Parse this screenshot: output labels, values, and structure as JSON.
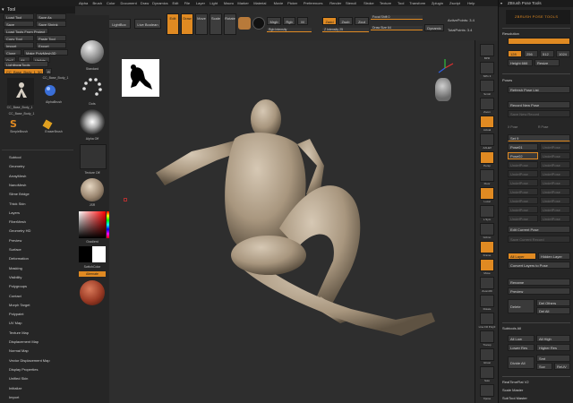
{
  "top_menu": [
    "Alpha",
    "Brush",
    "Color",
    "Document",
    "Draw",
    "Dynamics",
    "Edit",
    "File",
    "Layer",
    "Light",
    "Macro",
    "Marker",
    "Material",
    "Movie",
    "Picker",
    "Preferences",
    "Render",
    "Stencil",
    "Stroke",
    "Texture",
    "Tool",
    "Transform",
    "Zplugin",
    "Zscript",
    "Help"
  ],
  "tool_panel": {
    "title": "Tool",
    "buttons": [
      "Load Tool",
      "Save As",
      "Save",
      "Save Shrink",
      "Load Tools From Project",
      "Copy Tool",
      "Paste Tool",
      "Import",
      "Export",
      "Clone",
      "Make PolyMesh3D",
      "GoZ",
      "All",
      "Visible",
      "R"
    ],
    "lightbox_tools": "Lightbox▸Tools",
    "current_tool": "CC_Base_Body_1. 50",
    "thumbs": [
      {
        "label": "CC_Base_Body_1"
      },
      {
        "label": "CC_Base_Body_1"
      },
      {
        "label": "AlphaBrush"
      },
      {
        "label": "CC_Base_Body_1"
      },
      {
        "label": "SimpleBrush"
      },
      {
        "label": "EraserBrush"
      }
    ],
    "subtools": [
      "Subtool",
      "Geometry",
      "ArrayMesh",
      "NanoMesh",
      "Slime Bridge",
      "Thick Skin",
      "Layers",
      "FiberMesh",
      "Geometry HD",
      "Preview",
      "Surface",
      "Deformation",
      "Masking",
      "Visibility",
      "Polygroups",
      "Contact",
      "Morph Target",
      "Polypaint",
      "UV Map",
      "Texture Map",
      "Displacement Map",
      "Normal Map",
      "Vector Displacement Map",
      "Display Properties",
      "Unified Skin",
      "Initialize",
      "Import"
    ]
  },
  "material_column": {
    "standard": "Standard",
    "dots": "Dots",
    "alpha": "Alpha Off",
    "texture": "Texture Off",
    "matcap": "JSR",
    "gradient": "Gradient",
    "switch_color": "SwitchColor",
    "alternate": "Alternate"
  },
  "top_shelf": {
    "home_page": "Home Page",
    "lightbox": "LightBox",
    "live_boolean": "Live Boolean",
    "edit": "Edit",
    "draw": "Draw",
    "move": "Move",
    "scale": "Scale",
    "rotate": "Rotate",
    "mrgb": "Mrgb",
    "rgb": "Rgb",
    "m": "M",
    "rgb_intensity": "Rgb Intensity",
    "zadd": "Zadd",
    "zsub": "Zsub",
    "zcut": "Zcut",
    "z_intensity": "Z Intensity 25",
    "focal_shift": "Focal Shift 0",
    "draw_size": "Draw Size 64",
    "dynamic": "Dynamic",
    "active_points": "ActivePoints: 3.4",
    "total_points": "TotalPoints: 3.4"
  },
  "right_shelf": [
    "BPR",
    "SPix 3",
    "Scroll",
    "Zoom",
    "Actual",
    "AAHalf",
    "Persp",
    "Floor",
    "Local",
    "L.Sym",
    "Gizmo",
    "Frame",
    "Move",
    "Zoom3D",
    "Rotate",
    "Line Fill PolyF",
    "Transp",
    "Ghost",
    "Solo",
    "Xpose"
  ],
  "right_panel": {
    "title": "ZBrush Pose Tools",
    "logo_text": "ZBRUSH POSE TOOLS",
    "resolution_section": "Resolution",
    "res_values": [
      "128",
      "256",
      "512",
      "1024"
    ],
    "height_label": "Height 666",
    "resize": "Resize",
    "poses_section": "Poses",
    "refresh_pose_list": "Refresh Pose List",
    "record_new_pose": "Record New Pose",
    "save_new_record": "Save New Record",
    "col_headers": [
      "X Pose",
      "R Pose"
    ],
    "set_label": "Set 9",
    "poses": [
      [
        "Pose01",
        "UndefPose"
      ],
      [
        "Pose02",
        "UndefPose"
      ],
      [
        "UndefPose",
        "UndefPose"
      ],
      [
        "UndefPose",
        "UndefPose"
      ],
      [
        "UndefPose",
        "UndefPose"
      ],
      [
        "UndefPose",
        "UndefPose"
      ],
      [
        "UndefPose",
        "UndefPose"
      ],
      [
        "UndefPose",
        "UndefPose"
      ],
      [
        "UndefPose",
        "UndefPose"
      ]
    ],
    "edit_current_pose": "Edit Current Pose",
    "save_current_record": "Save Current Record",
    "all_layer": "All Layer",
    "hidden_layer": "Hidden Layer",
    "convert_layers": "Convert Layers to Pose",
    "rename": "Rename",
    "preview": "Preview",
    "delete": "Delete",
    "del_others": "Del Others",
    "del_all": "Del All",
    "subtools_section": "Subtools All",
    "all_low": "All Low",
    "all_high": "All High",
    "lower_res": "Lower Res",
    "higher_res": "Higher Res",
    "divide_all": "Divide All",
    "smt": "Smt",
    "suv": "Suv",
    "reuv": "ReUV",
    "realtime": "RealTimeFlat V2",
    "scale_master": "Scale Master",
    "subtool_master": "SubTool Master"
  },
  "accent_color": "#e08a22"
}
